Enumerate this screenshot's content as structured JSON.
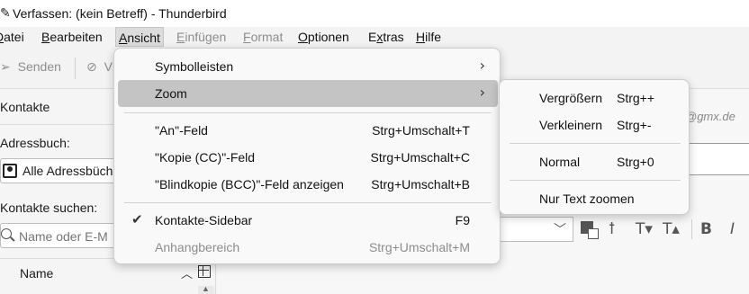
{
  "window": {
    "title": "Verfassen: (kein Betreff) - Thunderbird",
    "icon": "pencil-icon"
  },
  "menubar": {
    "items": [
      {
        "label": "Datei",
        "visible": "Datei",
        "ul": "D"
      },
      {
        "label": "Bearbeiten",
        "ul": "B"
      },
      {
        "label": "Ansicht",
        "ul": "A"
      },
      {
        "label": "Einfügen",
        "ul": "E"
      },
      {
        "label": "Format",
        "ul": "F"
      },
      {
        "label": "Optionen",
        "ul": "O"
      },
      {
        "label": "Extras",
        "ul": "x"
      },
      {
        "label": "Hilfe",
        "ul": "H"
      }
    ]
  },
  "toolbar": {
    "send_label": "Senden",
    "second_label": "V"
  },
  "sidebar": {
    "header": "Kontakte",
    "addressbook_label": "Adressbuch:",
    "addressbook_value": "Alle Adressbüch",
    "search_label": "Kontakte suchen:",
    "search_placeholder": "Name oder E-M",
    "column_name": "Name"
  },
  "compose": {
    "from_suffix": "@gmx.de"
  },
  "ansicht_menu": {
    "items": [
      {
        "label": "Symbolleisten",
        "shortcut": "",
        "submenu": true
      },
      {
        "label": "Zoom",
        "shortcut": "",
        "submenu": true,
        "highlighted": true
      },
      {
        "label": "\"An\"-Feld",
        "shortcut": "Strg+Umschalt+T"
      },
      {
        "label": "\"Kopie (CC)\"-Feld",
        "shortcut": "Strg+Umschalt+C"
      },
      {
        "label": "\"Blindkopie (BCC)\"-Feld anzeigen",
        "shortcut": "Strg+Umschalt+B"
      },
      {
        "label": "Kontakte-Sidebar",
        "shortcut": "F9",
        "checked": true
      },
      {
        "label": "Anhangbereich",
        "shortcut": "Strg+Umschalt+M",
        "disabled": true
      }
    ]
  },
  "zoom_menu": {
    "items": [
      {
        "label": "Vergrößern",
        "shortcut": "Strg++"
      },
      {
        "label": "Verkleinern",
        "shortcut": "Strg+-"
      },
      {
        "label": "Normal",
        "shortcut": "Strg+0"
      },
      {
        "label": "Nur Text zoomen",
        "shortcut": ""
      }
    ]
  },
  "icons": {
    "submenu_arrow": "chevron-right-icon",
    "check": "checkmark-icon"
  },
  "colors": {
    "menu_highlight": "#c4c4c4",
    "disabled_text": "#8d8d8d"
  }
}
